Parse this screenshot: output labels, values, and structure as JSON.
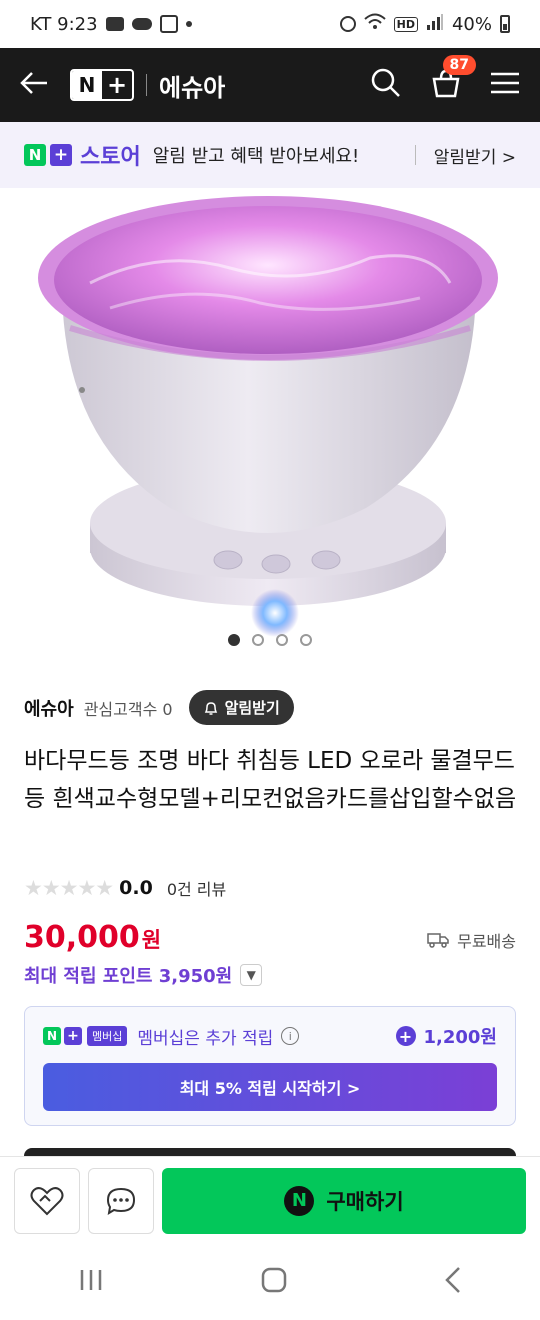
{
  "status_bar": {
    "carrier_time": "KT 9:23",
    "battery": "40%",
    "network": "HD"
  },
  "header": {
    "store_name": "에슈아",
    "cart_count": "87"
  },
  "banner": {
    "brand": "스토어",
    "message": "알림 받고 혜택 받아보세요!",
    "link": "알림받기 >"
  },
  "gallery": {
    "count": 4,
    "active_index": 0
  },
  "seller": {
    "name": "에슈아",
    "fans": "관심고객수 0",
    "alarm_button": "알림받기"
  },
  "product": {
    "title": "바다무드등 조명 바다 취침등 LED 오로라 물결무드등 흰색교수형모델+리모컨없음카드를삽입할수없음",
    "rating": "0.0",
    "reviews": "0건 리뷰",
    "price": "30,000",
    "price_unit": "원",
    "shipping": "무료배송",
    "max_points": "최대 적립 포인트 3,950원"
  },
  "membership": {
    "badge": "멤버십",
    "text": "멤버십은 추가 적립",
    "extra_points": "1,200원",
    "cta": "최대 5% 적립 시작하기 >"
  },
  "buy_bar": {
    "buy_label": "구매하기"
  },
  "colors": {
    "naver_green": "#03c75a",
    "plus_purple": "#5b3fd6",
    "price_red": "#e0002a",
    "header_dark": "#1a1a1a"
  }
}
